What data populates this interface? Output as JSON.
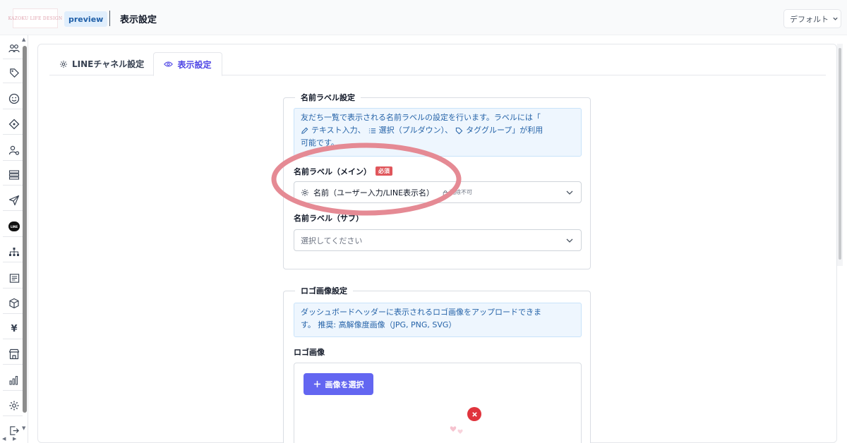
{
  "header": {
    "logo_text": "KAZOKU LIFE DESIGN",
    "badge": "preview",
    "title": "表示設定",
    "view_select": "デフォルト"
  },
  "sidebar": {
    "items": [
      {
        "icon": "users-icon"
      },
      {
        "icon": "tag-icon"
      },
      {
        "icon": "smile-icon"
      },
      {
        "icon": "diamond-icon"
      },
      {
        "icon": "user-gear-icon"
      },
      {
        "icon": "list-icon"
      },
      {
        "icon": "send-icon"
      },
      {
        "icon": "line-icon",
        "label": "LINE"
      },
      {
        "icon": "hierarchy-icon"
      },
      {
        "icon": "document-icon"
      },
      {
        "icon": "box-icon"
      },
      {
        "icon": "yen-icon",
        "label": "¥"
      },
      {
        "icon": "store-icon"
      },
      {
        "icon": "chart-icon"
      },
      {
        "icon": "settings-icon"
      },
      {
        "icon": "logout-icon"
      }
    ]
  },
  "tabs": [
    {
      "label": "LINEチャネル設定",
      "icon": "gear-icon",
      "active": false
    },
    {
      "label": "表示設定",
      "icon": "eye-icon",
      "active": true
    }
  ],
  "name_label_section": {
    "title": "名前ラベル設定",
    "info_line1": "友だち一覧で表示される名前ラベルの設定を行います。ラベルには「",
    "info_text_input": "テキスト入力、",
    "info_select": "選択（プルダウン）、",
    "info_tag_group": "タググループ」が利用",
    "info_line3": "可能です。",
    "main_label": "名前ラベル（メイン）",
    "required_badge": "必須",
    "main_value": "名前（ユーザー入力/LINE表示名）",
    "main_note": "削除不可",
    "sub_label": "名前ラベル（サブ）",
    "sub_placeholder": "選択してください"
  },
  "logo_section": {
    "title": "ロゴ画像設定",
    "info_line1": "ダッシュボードヘッダーに表示されるロゴ画像をアップロードできま",
    "info_line2": "す。 推奨: 高解像度画像（JPG, PNG, SVG）",
    "logo_label": "ロゴ画像",
    "select_button": "画像を選択"
  },
  "colors": {
    "accent": "#6366f1",
    "info_bg": "#eef6fe",
    "info_text": "#2563a8",
    "required": "#e0565b",
    "highlight": "#e58a94"
  }
}
